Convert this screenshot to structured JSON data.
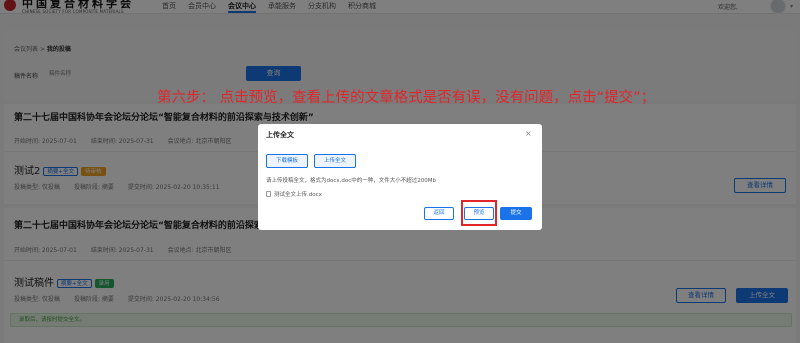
{
  "header": {
    "logo_cn": "中国复合材料学会",
    "logo_en": "CHINESE SOCIETY FOR COMPOSITE MATERIALS",
    "nav": [
      "首页",
      "会员中心",
      "会议中心",
      "承能服务",
      "分支机构",
      "积分商城"
    ],
    "active_nav": "会议中心",
    "welcome": "欢迎您,"
  },
  "breadcrumb": {
    "parent": "会议列表",
    "separator": ">",
    "current": "我的投稿"
  },
  "filter": {
    "label": "稿件名称",
    "placeholder": "稿件名称",
    "query_button": "查询"
  },
  "conferences": [
    {
      "title": "第二十七届中国科协年会论坛分论坛“智能复合材料的前沿探索与技术创新”",
      "meta": [
        "开始时间: 2025-07-01",
        "结束时间: 2025-07-31",
        "会议地点: 北京市朝阳区"
      ],
      "paper": {
        "name": "测试2",
        "tags": [
          "摘要+全文",
          "待审核"
        ],
        "meta": [
          "投稿类型: 仅投稿",
          "投稿阶段: 摘要",
          "提交时间: 2025-02-20 10:35:11"
        ],
        "button": "查看详情"
      }
    },
    {
      "title": "第二十七届中国科协年会论坛分论坛“智能复合材料的前沿探索与技术创新”",
      "meta": [
        "开始时间: 2025-07-01",
        "结束时间: 2025-07-31",
        "会议地点: 北京市朝阳区"
      ],
      "paper": {
        "name": "测试稿件",
        "tags": [
          "摘要+全文",
          "录用"
        ],
        "meta": [
          "投稿类型: 仅投稿",
          "投稿阶段: 摘要",
          "提交时间: 2025-02-20 10:34:56"
        ],
        "buttons": [
          "查看详情",
          "上传全文"
        ],
        "notice": "录取后，请按时提交全文。"
      }
    }
  ],
  "dialog": {
    "title": "上传全文",
    "close": "×",
    "download_template": "下载模板",
    "upload": "上传全文",
    "hint": "请上传投稿全文，格式为docx,doc中的一种，文件大小不超过200Mb",
    "file_name": "测试全文上传.docx",
    "back": "返回",
    "preview": "预览",
    "submit": "提交"
  },
  "annotation": "第六步：  点击预览，查看上传的文章格式是否有误，没有问题，点击“提交”；"
}
